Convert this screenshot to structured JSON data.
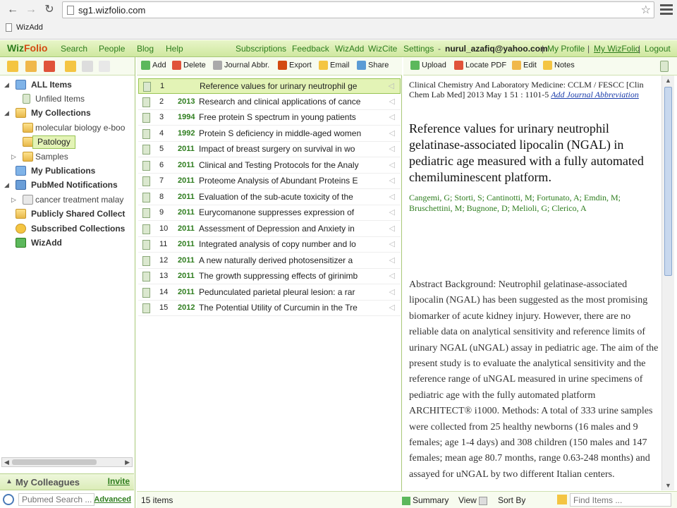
{
  "browser": {
    "url": "sg1.wizfolio.com",
    "bookmark": "WizAdd"
  },
  "appnav": {
    "logo_a": "Wiz",
    "logo_b": "Folio",
    "links": [
      "Search",
      "People",
      "Blog",
      "Help"
    ],
    "right_links": [
      "Subscriptions",
      "Feedback",
      "WizAdd",
      "WizCite",
      "Settings"
    ],
    "email": "nurul_azafiq@yahoo.com",
    "my_profile": "My Profile",
    "my_wizfolio": "My WizFolio",
    "logout": "Logout",
    "sep": "|",
    "dash": "-"
  },
  "tree": {
    "all_items": "ALL Items",
    "unfiled": "Unfiled Items",
    "my_collections": "My Collections",
    "molecular": "molecular biology e-boo",
    "patology": "Patology",
    "samples": "Samples",
    "my_publications": "My Publications",
    "pubmed": "PubMed Notifications",
    "cancer": "cancer treatment malay",
    "public": "Publicly Shared Collect",
    "subscribed": "Subscribed Collections",
    "wizadd": "WizAdd"
  },
  "left_footer": {
    "colleagues": "My Colleagues",
    "invite": "Invite",
    "pubmed_placeholder": "Pubmed Search ...",
    "advanced": "Advanced"
  },
  "mid_toolbar": {
    "add": "Add",
    "delete": "Delete",
    "journal": "Journal Abbr.",
    "export": "Export",
    "email": "Email",
    "share": "Share"
  },
  "items": [
    {
      "num": "1",
      "year": "",
      "title": "Reference values for urinary neutrophil ge"
    },
    {
      "num": "2",
      "year": "2013",
      "title": "Research and clinical applications of cance"
    },
    {
      "num": "3",
      "year": "1994",
      "title": "Free protein S spectrum in young patients"
    },
    {
      "num": "4",
      "year": "1992",
      "title": "Protein S deficiency in middle-aged women"
    },
    {
      "num": "5",
      "year": "2011",
      "title": "Impact of breast surgery on survival in wo"
    },
    {
      "num": "6",
      "year": "2011",
      "title": "Clinical and Testing Protocols for the Analy"
    },
    {
      "num": "7",
      "year": "2011",
      "title": "Proteome Analysis of Abundant Proteins E"
    },
    {
      "num": "8",
      "year": "2011",
      "title": "Evaluation of the sub-acute toxicity of the"
    },
    {
      "num": "9",
      "year": "2011",
      "title": "Eurycomanone suppresses expression of"
    },
    {
      "num": "10",
      "year": "2011",
      "title": "Assessment of Depression and Anxiety in"
    },
    {
      "num": "11",
      "year": "2011",
      "title": "Integrated analysis of copy number and lo"
    },
    {
      "num": "12",
      "year": "2011",
      "title": "A new naturally derived photosensitizer a"
    },
    {
      "num": "13",
      "year": "2011",
      "title": "The growth suppressing effects of girinimb"
    },
    {
      "num": "14",
      "year": "2011",
      "title": "Pedunculated parietal pleural lesion: a rar"
    },
    {
      "num": "15",
      "year": "2012",
      "title": "The Potential Utility of Curcumin in the Tre"
    }
  ],
  "mid_footer": {
    "count": "15 items"
  },
  "right_toolbar": {
    "upload": "Upload",
    "locate": "Locate PDF",
    "edit": "Edit",
    "notes": "Notes"
  },
  "detail": {
    "journal_ref": "Clinical Chemistry And Laboratory Medicine: CCLM / FESCC [Clin Chem Lab Med] 2013 May 1 51 : 1101-5",
    "add_abbr": "Add Journal Abbreviation",
    "title": "Reference values for urinary neutrophil gelatinase-associated lipocalin (NGAL) in pediatric age measured with a fully automated chemiluminescent platform.",
    "authors": "Cangemi, G; Storti, S; Cantinotti, M; Fortunato, A; Emdin, M; Bruschettini, M; Bugnone, D; Melioli, G; Clerico, A",
    "abstract": "Abstract Background: Neutrophil gelatinase-associated lipocalin (NGAL) has been suggested as the most promising biomarker of acute kidney injury. However, there are no reliable data on analytical sensitivity and reference limits of urinary NGAL (uNGAL) assay in pediatric age. The aim of the present study is to evaluate the analytical sensitivity and the reference range of uNGAL measured in urine specimens of pediatric age with the fully automated platform ARCHITECT® i1000. Methods: A total of 333 urine samples were collected from 25 healthy newborns (16 males and 9 females; age 1-4 days) and 308 children (150 males and 147 females; mean age 80.7 months, range 0.63-248 months) and assayed for uNGAL by two different Italian centers."
  },
  "right_footer": {
    "summary": "Summary",
    "view": "View",
    "sort_by": "Sort By",
    "find_placeholder": "Find Items ..."
  },
  "colors": {
    "brand_green": "#2e7d1e",
    "accent_orange": "#d34a12",
    "selection": "#e3f3b6"
  }
}
